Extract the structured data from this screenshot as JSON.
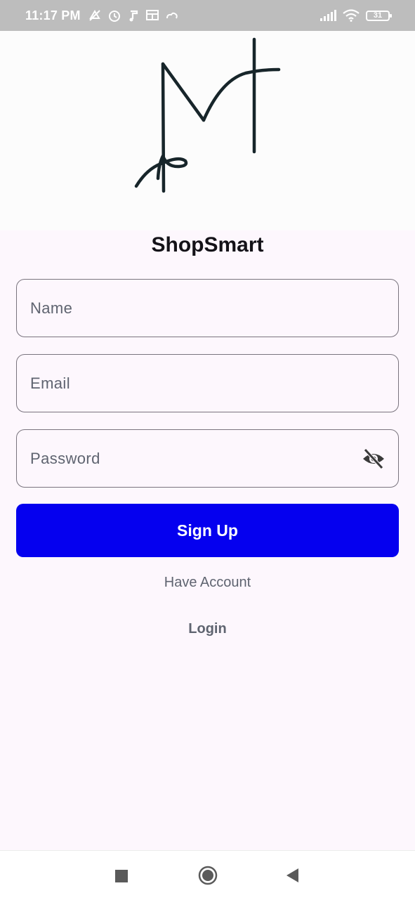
{
  "status_bar": {
    "time": "11:17 PM",
    "battery": "31",
    "icons": [
      "mute-icon",
      "alarm-icon",
      "music-icon",
      "news-icon",
      "cloud-icon",
      "signal-icon",
      "wifi-icon",
      "battery-icon"
    ]
  },
  "app": {
    "title": "ShopSmart"
  },
  "form": {
    "name_placeholder": "Name",
    "email_placeholder": "Email",
    "password_placeholder": "Password",
    "submit_label": "Sign Up"
  },
  "footer": {
    "have_account": "Have Account",
    "login_label": "Login"
  },
  "nav": {
    "buttons": [
      "recents-button",
      "home-button",
      "back-button"
    ]
  },
  "colors": {
    "primary": "#0500ef",
    "background": "#fdf7fd",
    "outline": "#79747e"
  }
}
